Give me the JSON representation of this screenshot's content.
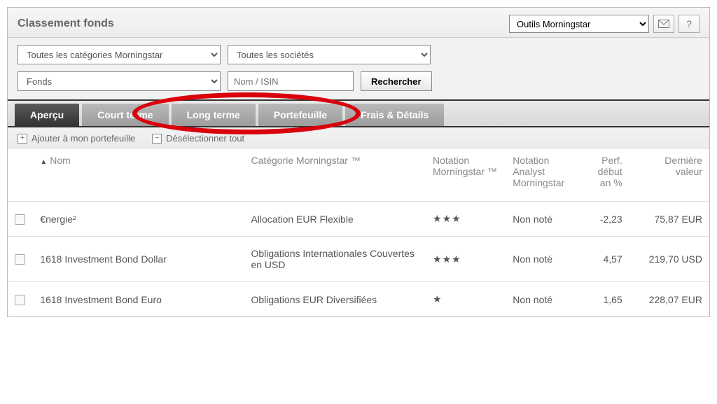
{
  "header": {
    "title": "Classement fonds",
    "tools_select": "Outils Morningstar"
  },
  "filters": {
    "category": "Toutes les catégories Morningstar",
    "company": "Toutes les sociétés",
    "type": "Fonds",
    "search_placeholder": "Nom / ISIN",
    "search_button": "Rechercher"
  },
  "tabs": {
    "overview": "Aperçu",
    "short_term": "Court terme",
    "long_term": "Long terme",
    "portfolio": "Portefeuille",
    "fees": "Frais & Détails"
  },
  "actions": {
    "add_portfolio": "Ajouter à mon portefeuille",
    "deselect_all": "Désélectionner tout"
  },
  "columns": {
    "name": "Nom",
    "category": "Catégorie Morningstar ™",
    "rating": "Notation Morningstar ™",
    "analyst": "Notation Analyst Morningstar",
    "perf": "Perf. début an %",
    "last": "Dernière valeur"
  },
  "rows": [
    {
      "name": "€nergie²",
      "category": "Allocation EUR Flexible",
      "stars": "★★★",
      "analyst": "Non noté",
      "perf": "-2,23",
      "last": "75,87 EUR"
    },
    {
      "name": "1618 Investment Bond Dollar",
      "category": "Obligations Internationales Couvertes en USD",
      "stars": "★★★",
      "analyst": "Non noté",
      "perf": "4,57",
      "last": "219,70 USD"
    },
    {
      "name": "1618 Investment Bond Euro",
      "category": "Obligations EUR Diversifiées",
      "stars": "★",
      "analyst": "Non noté",
      "perf": "1,65",
      "last": "228,07 EUR"
    }
  ]
}
